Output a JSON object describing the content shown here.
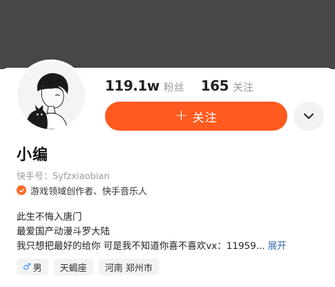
{
  "header": {
    "cover_color": "#474747"
  },
  "profile": {
    "avatar_icon": "avatar-illustration",
    "stats": [
      {
        "value": "119.1w",
        "label": "粉丝"
      },
      {
        "value": "165",
        "label": "关注"
      }
    ],
    "follow_button": {
      "icon": "+",
      "label": "关注",
      "color": "#ff5a1f"
    },
    "more_icon": "chevron-down-icon",
    "nickname": "小编",
    "user_id": "快手号：Syfzxiaobian",
    "certification": "游戏领域创作者、快手音乐人",
    "bio": [
      "此生不悔入唐门",
      "最爱国产动漫斗罗大陆",
      "我只想把最好的给你 可是我不知道你喜不喜欢vx：11959..."
    ],
    "expand_label": "展开",
    "tags": [
      {
        "icon": "male-icon",
        "glyph": "♂",
        "label": "男"
      },
      {
        "label": "天蝎座"
      },
      {
        "label": "河南 郑州市"
      }
    ]
  }
}
